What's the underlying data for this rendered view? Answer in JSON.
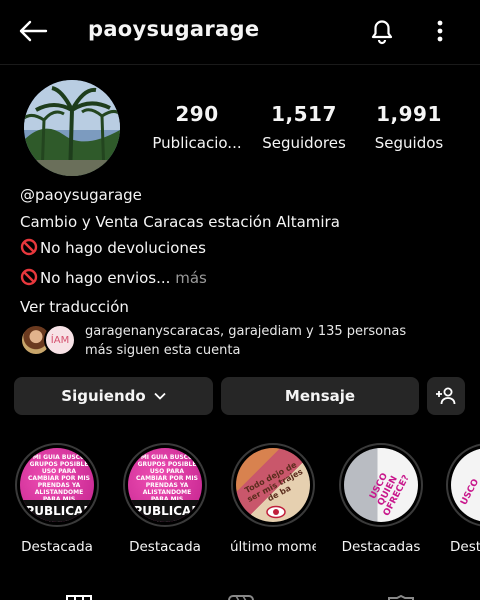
{
  "header": {
    "username": "paoysugarage"
  },
  "profile": {
    "stats": [
      {
        "value": "290",
        "label": "Publicacio..."
      },
      {
        "value": "1,517",
        "label": "Seguidores"
      },
      {
        "value": "1,991",
        "label": "Seguidos"
      }
    ],
    "bio": {
      "handle": "@paoysugarage",
      "line1": "Cambio y  Venta Caracas estación Altamira",
      "line2": "No hago devoluciones",
      "line3": "No hago envios...",
      "more": "más",
      "translate": "Ver traducción"
    },
    "followed_by": {
      "line1": "garagenanyscaracas, garajediam y 135 personas",
      "line2": "más siguen esta cuenta",
      "avatar2_text": "ÍAM"
    }
  },
  "actions": {
    "following": "Siguiendo",
    "message": "Mensaje"
  },
  "highlights": [
    {
      "label": "Destacada",
      "text1": "MI GUIA BUSCO GRUPOS POSIBLE USO PARA CAMBIAR POR MIS PRENDAS YA ALISTANDOME PARA MIS VACACIONES DE CARNAVALES QUIEN OFRECE? TENGO TRAJES DE BAÑOS SIN",
      "text2": "PUBLICAR"
    },
    {
      "label": "Destacada",
      "text1": "MI GUIA BUSCO GRUPOS POSIBLE USO PARA CAMBIAR POR MIS PRENDAS YA ALISTANDOME PARA MIS VACACIONES DE CARNAVALES QUIEN OFRECE? TENGO TRAJES DE BAÑOS SIN",
      "text2": "PUBLICAR"
    },
    {
      "label": "último mome...",
      "text1": "Todo dejo de ser mis trajes de ba"
    },
    {
      "label": "Destacadas",
      "text1": "USCO QUIEN OFRECE?"
    },
    {
      "label": "Dest",
      "text1": "USCO"
    }
  ],
  "colors": {
    "background": "#000000",
    "button_bg": "#262626",
    "pink": "#e03ca8",
    "red_prohibited": "#e8383d"
  }
}
